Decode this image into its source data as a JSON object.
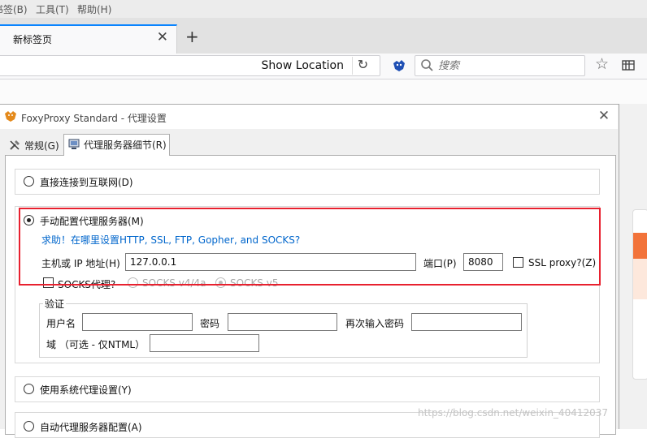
{
  "browser": {
    "menu": [
      "书签(B)",
      "工具(T)",
      "帮助(H)"
    ],
    "tab_title": "新标签页",
    "tab_close": "✕",
    "new_tab": "+",
    "show_location": "Show Location",
    "reload": "↻",
    "search_placeholder": "搜索",
    "star": "☆"
  },
  "dialog": {
    "title": "FoxyProxy Standard - 代理设置",
    "close": "✕",
    "tabs": [
      {
        "label": "常规(G)",
        "icon": "tools-icon"
      },
      {
        "label": "代理服务器细节(R)",
        "icon": "server-icon",
        "active": true
      }
    ],
    "direct": {
      "label": "直接连接到互联网(D)",
      "checked": false
    },
    "manual": {
      "label": "手动配置代理服务器(M)",
      "checked": true,
      "help_link": "求助！在哪里设置HTTP, SSL, FTP, Gopher, and SOCKS?",
      "host_label": "主机或 IP 地址(H)",
      "host_value": "127.0.0.1",
      "port_label": "端口(P)",
      "port_value": "8080",
      "ssl_label": "SSL proxy?(Z)",
      "socks_label": "SOCKS代理?",
      "socks_v4": "SOCKS v4/4a",
      "socks_v5": "SOCKS v5"
    },
    "auth": {
      "legend": "验证",
      "username_label": "用户名",
      "password_label": "密码",
      "confirm_label": "再次输入密码",
      "domain_label": "域 （可选 - 仅NTML）"
    },
    "system": {
      "label": "使用系统代理设置(Y)"
    },
    "auto": {
      "label": "自动代理服务器配置(A)"
    }
  },
  "watermark": "https://blog.csdn.net/weixin_40412037",
  "colors": {
    "highlight": "#e8212f",
    "link": "#0066cc",
    "tab_accent": "#0a84ff"
  }
}
